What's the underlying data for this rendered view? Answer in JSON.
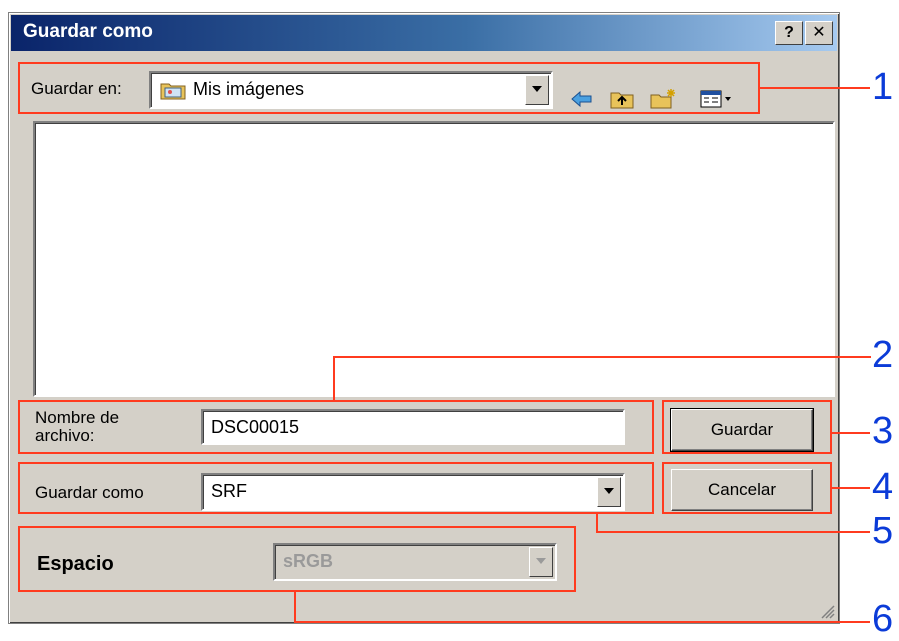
{
  "window": {
    "title": "Guardar como",
    "help_btn": "?",
    "close_btn": "✕"
  },
  "toolbar": {
    "save_in_label": "Guardar en:",
    "save_in_value": "Mis imágenes",
    "icons": [
      "back-arrow-icon",
      "up-folder-icon",
      "new-folder-icon",
      "view-menu-icon"
    ]
  },
  "fields": {
    "filename_label_line1": "Nombre de",
    "filename_label_line2": "archivo:",
    "filename_value": "DSC00015",
    "filetype_label": "Guardar como",
    "filetype_value": "SRF",
    "space_label": "Espacio",
    "space_value": "sRGB"
  },
  "buttons": {
    "save": "Guardar",
    "cancel": "Cancelar"
  },
  "callouts": [
    "1",
    "2",
    "3",
    "4",
    "5",
    "6"
  ],
  "colors": {
    "callout_box": "#ff3b1f",
    "callout_number": "#0b3bd8",
    "title_bar": "#0a246a"
  }
}
